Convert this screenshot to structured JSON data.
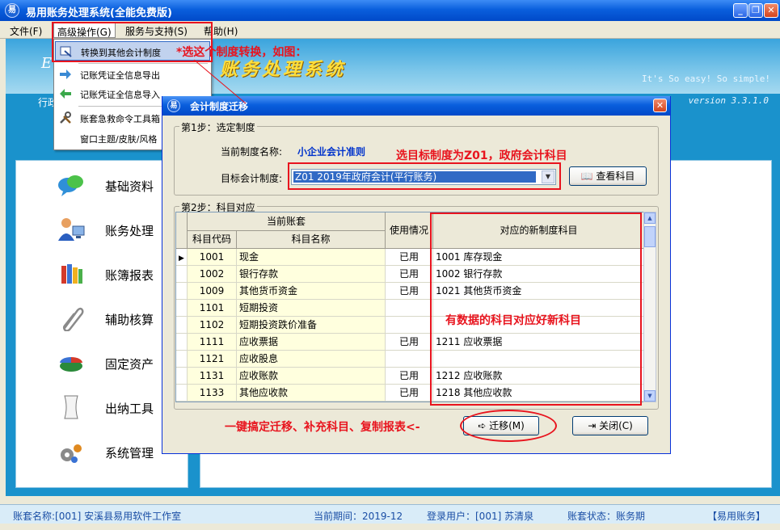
{
  "window": {
    "title": "易用账务处理系统(全能免费版)",
    "app_icon": "易"
  },
  "menubar": [
    {
      "label": "文件(F)"
    },
    {
      "label": "高级操作(G)"
    },
    {
      "label": "服务与支持(S)"
    },
    {
      "label": "帮助(H)"
    }
  ],
  "dropdown": {
    "items": [
      {
        "label": "转换到其他会计制度",
        "icon": "convert-icon"
      },
      {
        "label": "记账凭证全信息导出",
        "icon": "export-arrow-icon"
      },
      {
        "label": "记账凭证全信息导入",
        "icon": "import-arrow-icon"
      },
      {
        "label": "账套急救命令工具箱",
        "icon": "tools-icon"
      },
      {
        "label": "窗口主题/皮肤/风格",
        "icon": ""
      }
    ]
  },
  "banner": {
    "logo_letter": "E",
    "title": "账务处理系统",
    "slogan": "It's So easy! So simple!",
    "nav_left": "行政",
    "version": "version 3.3.1.0"
  },
  "sidebar": [
    {
      "label": "基础资料",
      "icon": "chat-bubble-icon"
    },
    {
      "label": "账务处理",
      "icon": "user-computer-icon"
    },
    {
      "label": "账簿报表",
      "icon": "books-icon"
    },
    {
      "label": "辅助核算",
      "icon": "paperclip-icon"
    },
    {
      "label": "固定资产",
      "icon": "pie-chart-icon"
    },
    {
      "label": "出纳工具",
      "icon": "document-icon"
    },
    {
      "label": "系统管理",
      "icon": "gears-icon"
    }
  ],
  "dialog": {
    "title": "会计制度迁移",
    "close_glyph": "✕",
    "step1": {
      "legend": "第1步：选定制度",
      "current_label": "当前制度名称:",
      "current_value": "小企业会计准则",
      "target_label": "目标会计制度:",
      "target_value": "Z01 2019年政府会计(平行账务)",
      "view_button": "查看科目"
    },
    "step2": {
      "legend": "第2步：科目对应",
      "header_group": "当前账套",
      "col_code": "科目代码",
      "col_name": "科目名称",
      "col_usage": "使用情况",
      "col_new": "对应的新制度科目",
      "rows": [
        {
          "code": "1001",
          "name": "现金",
          "usage": "已用",
          "new": "1001 库存现金"
        },
        {
          "code": "1002",
          "name": "银行存款",
          "usage": "已用",
          "new": "1002 银行存款"
        },
        {
          "code": "1009",
          "name": "其他货币资金",
          "usage": "已用",
          "new": "1021 其他货币资金"
        },
        {
          "code": "1101",
          "name": "短期投资",
          "usage": "",
          "new": ""
        },
        {
          "code": "1102",
          "name": "短期投资跌价准备",
          "usage": "",
          "new": ""
        },
        {
          "code": "1111",
          "name": "应收票据",
          "usage": "已用",
          "new": "1211 应收票据"
        },
        {
          "code": "1121",
          "name": "应收股息",
          "usage": "",
          "new": ""
        },
        {
          "code": "1131",
          "name": "应收账款",
          "usage": "已用",
          "new": "1212 应收账款"
        },
        {
          "code": "1133",
          "name": "其他应收款",
          "usage": "已用",
          "new": "1218 其他应收款"
        }
      ]
    },
    "migrate_button": "迁移(M)",
    "close_button": "关闭(C)"
  },
  "annotations": {
    "select_conversion": "*选这个制度转换，如图：",
    "target_hint": "选目标制度为Z01，政府会计科目",
    "mapping_hint": "有数据的科目对应好新科目",
    "one_click_hint": "一键搞定迁移、补充科目、复制报表<-"
  },
  "statusbar": {
    "account_set": "账套名称:[001] 安溪县易用软件工作室",
    "period": "当前期间：2019-12",
    "user": "登录用户：[001] 苏清泉",
    "status": "账套状态：账务期",
    "brand": "【易用账务】"
  },
  "colors": {
    "title_blue": "#0a5fdd",
    "panel_blue": "#1a92cc",
    "annotation_red": "#e8141e",
    "selection_blue": "#316ac5"
  }
}
